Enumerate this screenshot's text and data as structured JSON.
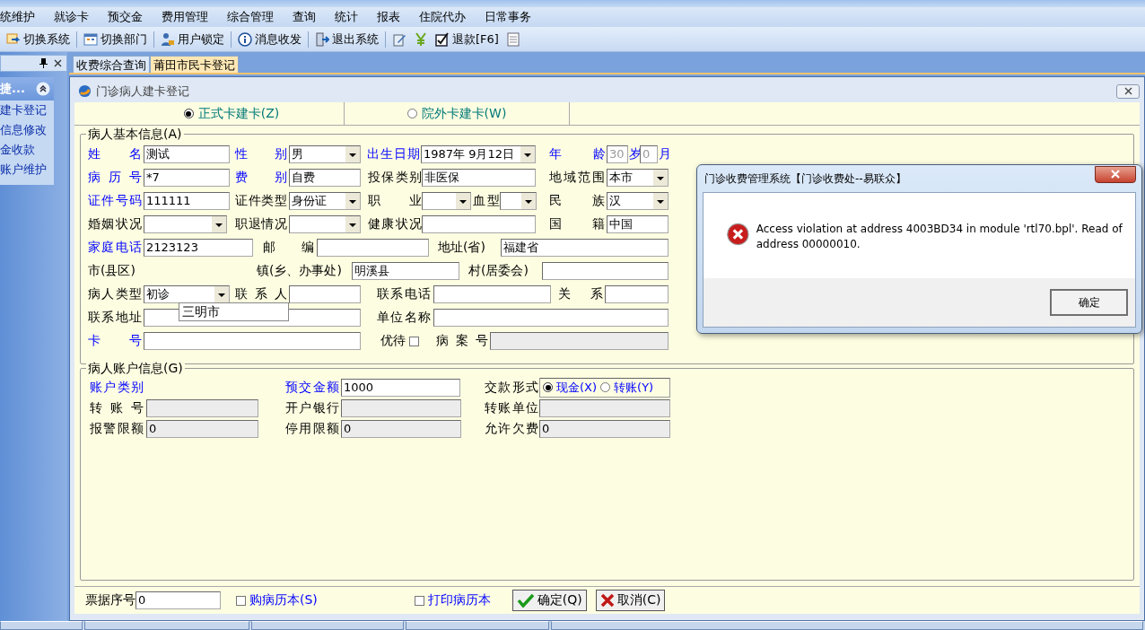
{
  "menu": [
    "统维护",
    "就诊卡",
    "预交金",
    "费用管理",
    "综合管理",
    "查询",
    "统计",
    "报表",
    "住院代办",
    "日常事务"
  ],
  "toolbar": [
    {
      "kind": "switch",
      "label": "切换系统"
    },
    {
      "kind": "calendar",
      "label": "切换部门"
    },
    {
      "kind": "user",
      "label": "用户锁定"
    },
    {
      "kind": "info",
      "label": "消息收发"
    },
    {
      "kind": "exit",
      "label": "退出系统"
    },
    {
      "kind": "edit"
    },
    {
      "kind": "yen"
    },
    {
      "kind": "check",
      "label": "退款[F6]"
    },
    {
      "kind": "doc"
    }
  ],
  "sidebar": {
    "title": "捷...",
    "items": [
      "建卡登记",
      "信息修改",
      "金收款",
      "账户维护"
    ]
  },
  "tabs": [
    {
      "label": "收费综合查询",
      "selected": false
    },
    {
      "label": "莆田市民卡登记",
      "selected": true
    }
  ],
  "window": {
    "title": "门诊病人建卡登记"
  },
  "card_types": [
    {
      "label": "正式卡建卡(Z)",
      "selected": true
    },
    {
      "label": "院外卡建卡(W)",
      "selected": false
    }
  ],
  "basic": {
    "legend": "病人基本信息(A)",
    "fields": [
      {
        "label": "姓名",
        "required": true,
        "kind": "text",
        "value": "测试"
      },
      {
        "label": "性别",
        "required": true,
        "kind": "select",
        "value": "男"
      },
      {
        "label": "出生日期",
        "required": true,
        "kind": "select",
        "value": "1987年 9月12日"
      },
      {
        "label": "年龄",
        "required": true,
        "kind": "dim",
        "value": "30"
      },
      {
        "label": "岁",
        "required": true,
        "kind": "dim",
        "value": "0"
      },
      {
        "label": "月",
        "required": true
      },
      {
        "label": "病历号",
        "required": true,
        "kind": "text",
        "value": "*7"
      },
      {
        "label": "费别",
        "required": true,
        "kind": "text",
        "value": "自费"
      },
      {
        "label": "投保类别",
        "required": false,
        "kind": "text",
        "value": "非医保"
      },
      {
        "label": "地域范围",
        "required": false,
        "kind": "select",
        "value": "本市"
      },
      {
        "label": "证件号码",
        "required": true,
        "kind": "text",
        "value": "111111"
      },
      {
        "label": "证件类型",
        "required": false,
        "kind": "select",
        "value": "身份证"
      },
      {
        "label": "职业",
        "required": false,
        "kind": "select"
      },
      {
        "label": "血型",
        "required": false,
        "kind": "select"
      },
      {
        "label": "民族",
        "required": false,
        "kind": "select",
        "value": "汉"
      },
      {
        "label": "婚姻状况",
        "required": false,
        "kind": "select"
      },
      {
        "label": "职退情况",
        "required": false,
        "kind": "select"
      },
      {
        "label": "健康状况",
        "required": false,
        "kind": "text"
      },
      {
        "label": "国籍",
        "required": false,
        "kind": "text",
        "value": "中国"
      },
      {
        "label": "家庭电话",
        "required": true,
        "kind": "text",
        "value": "2123123"
      },
      {
        "label": "邮编",
        "required": false,
        "kind": "text"
      },
      {
        "label": "地址(省)",
        "required": false,
        "kind": "text",
        "value": "福建省"
      },
      {
        "label": "市(县区)",
        "required": false
      },
      {
        "label": "镇(乡、办事处)",
        "required": false,
        "kind": "text",
        "value": "明溪县"
      },
      {
        "label": "村(居委会)",
        "required": false,
        "kind": "text"
      },
      {
        "label": "病人类型",
        "required": false,
        "kind": "select",
        "value": "初诊"
      },
      {
        "label": "联系人",
        "required": false,
        "kind": "text"
      },
      {
        "label": "联系电话",
        "required": false,
        "kind": "text"
      },
      {
        "label": "关系",
        "required": false,
        "kind": "text"
      },
      {
        "label": "联系地址",
        "required": false,
        "kind": "text"
      },
      {
        "label": "单位名称",
        "required": false,
        "kind": "text"
      },
      {
        "label": "卡号",
        "required": true,
        "kind": "text"
      },
      {
        "label": "优待",
        "required": false,
        "kind": "checkbox",
        "checked": false
      },
      {
        "label": "病案号",
        "required": false,
        "kind": "readonly"
      }
    ]
  },
  "dropdown_popup": {
    "value": "三明市"
  },
  "account": {
    "legend": "病人账户信息(G)",
    "fields": [
      {
        "label": "账户类别",
        "required": true
      },
      {
        "label": "预交金额",
        "required": true,
        "kind": "text",
        "value": "1000"
      },
      {
        "label": "交款形式",
        "required": false,
        "kind": "radios",
        "options": [
          {
            "label": "现金(X)",
            "selected": true
          },
          {
            "label": "转账(Y)",
            "selected": false
          }
        ]
      },
      {
        "label": "转账号",
        "required": false,
        "kind": "readonly"
      },
      {
        "label": "开户银行",
        "required": false,
        "kind": "readonly"
      },
      {
        "label": "转账单位",
        "required": false,
        "kind": "readonly"
      },
      {
        "label": "报警限额",
        "required": false,
        "kind": "readonly",
        "value": "0"
      },
      {
        "label": "停用限额",
        "required": false,
        "kind": "readonly",
        "value": "0"
      },
      {
        "label": "允许欠费",
        "required": false,
        "kind": "readonly",
        "value": "0"
      }
    ]
  },
  "footer": {
    "receipt_label": "票据序号",
    "receipt_value": "0",
    "checks": [
      {
        "label": "购病历本(S)",
        "checked": false
      },
      {
        "label": "打印病历本",
        "checked": false
      }
    ],
    "buttons": [
      {
        "kind": "ok",
        "label": "确定(Q)"
      },
      {
        "kind": "cancel",
        "label": "取消(C)"
      }
    ]
  },
  "dialog": {
    "title": "门诊收费管理系统【门诊收费处--易联众】",
    "message": "Access violation at address 4003BD34 in module 'rtl70.bpl'. Read of address 00000010.",
    "button": "确定"
  }
}
